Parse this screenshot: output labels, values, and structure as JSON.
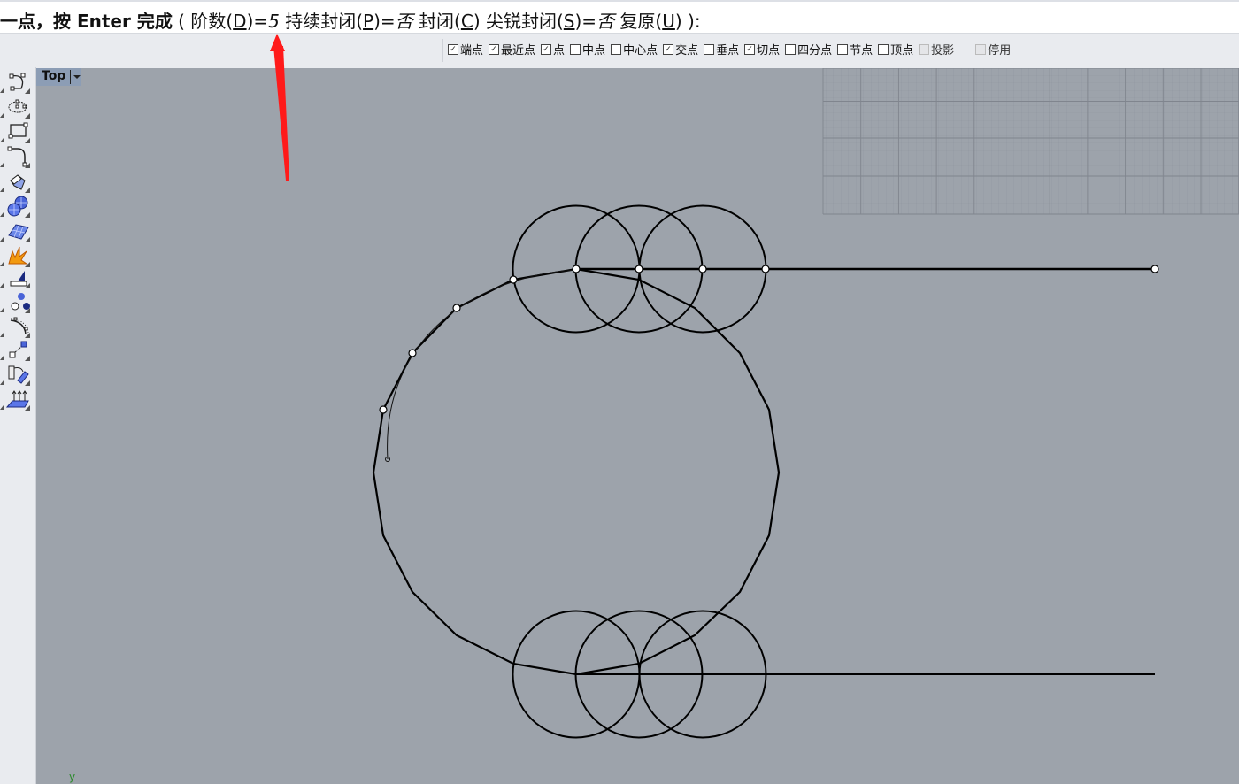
{
  "command_prompt": {
    "prefix": "一点，按 Enter 完成",
    "open_paren": " ( ",
    "options": [
      {
        "label": "阶数(",
        "key": "D",
        "after": ")=",
        "value": "5"
      },
      {
        "label": " 持续封闭(",
        "key": "P",
        "after": ")=",
        "value": "否"
      },
      {
        "label": " 封闭(",
        "key": "C",
        "after": ")",
        "value": null
      },
      {
        "label": "  尖锐封闭(",
        "key": "S",
        "after": ")=",
        "value": "否"
      },
      {
        "label": " 复原(",
        "key": "U",
        "after": ")",
        "value": null
      }
    ],
    "close": " ):"
  },
  "osnap": {
    "items": [
      {
        "label": "端点",
        "checked": true,
        "enabled": true
      },
      {
        "label": "最近点",
        "checked": true,
        "enabled": true
      },
      {
        "label": "点",
        "checked": true,
        "enabled": true
      },
      {
        "label": "中点",
        "checked": false,
        "enabled": true
      },
      {
        "label": "中心点",
        "checked": false,
        "enabled": true
      },
      {
        "label": "交点",
        "checked": true,
        "enabled": true
      },
      {
        "label": "垂点",
        "checked": false,
        "enabled": true
      },
      {
        "label": "切点",
        "checked": true,
        "enabled": true
      },
      {
        "label": "四分点",
        "checked": false,
        "enabled": true
      },
      {
        "label": "节点",
        "checked": false,
        "enabled": true
      },
      {
        "label": "顶点",
        "checked": false,
        "enabled": true
      },
      {
        "label": "投影",
        "checked": false,
        "enabled": false
      },
      {
        "label": "停用",
        "checked": false,
        "enabled": false
      }
    ]
  },
  "toolbar": {
    "tools": [
      "curve-tool-icon",
      "ellipse-tool-icon",
      "rectangle-tool-icon",
      "fillet-curve-icon",
      "surface-tool-icon",
      "solid-spheres-icon",
      "mesh-surface-icon",
      "explode-icon",
      "dimension-icon",
      "points-icon",
      "arc-edit-icon",
      "transform-icon",
      "extrude-icon",
      "array-icon"
    ]
  },
  "viewport": {
    "name": "Top",
    "axis_label": "y",
    "colors": {
      "background": "#9da3ab",
      "curve": "#000000",
      "annotation_arrow": "#ff1a1a",
      "axis": "#2a8a2a"
    }
  }
}
